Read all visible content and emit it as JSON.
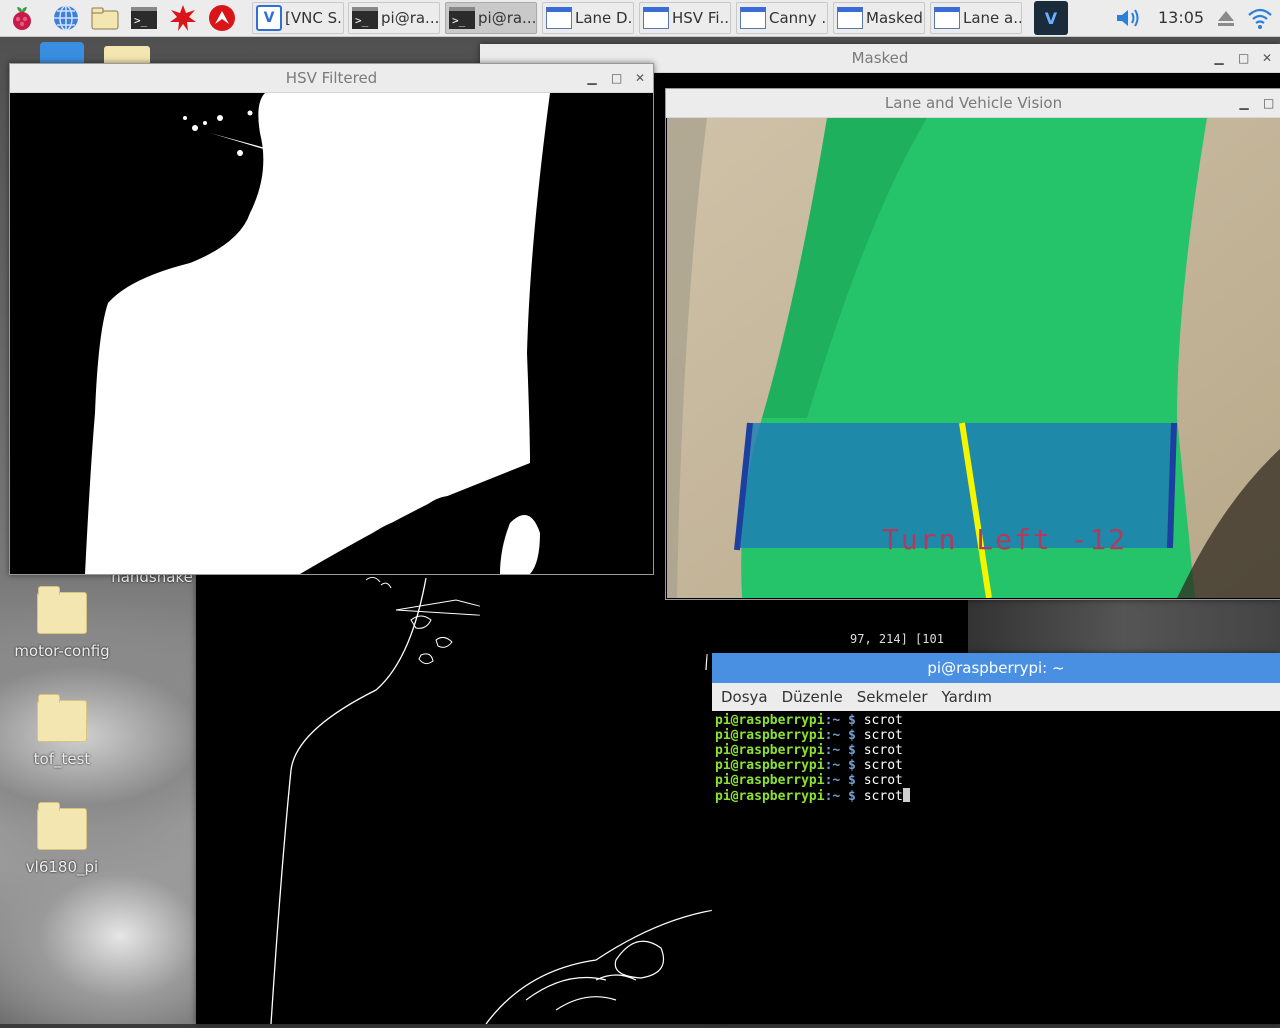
{
  "taskbar": {
    "tasks": [
      {
        "label": "[VNC S...",
        "icon": "vnc-icon"
      },
      {
        "label": "pi@ra...",
        "icon": "terminal-icon"
      },
      {
        "label": "pi@ra...",
        "icon": "terminal-icon"
      },
      {
        "label": "Lane D...",
        "icon": "window-icon"
      },
      {
        "label": "HSV Fi...",
        "icon": "window-icon"
      },
      {
        "label": "Canny ...",
        "icon": "window-icon"
      },
      {
        "label": "Masked",
        "icon": "window-icon"
      },
      {
        "label": "Lane a...",
        "icon": "window-icon"
      }
    ],
    "clock": "13:05"
  },
  "desktop_icons": [
    {
      "label": "handshake"
    },
    {
      "label": "motor-config"
    },
    {
      "label": "tof_test"
    },
    {
      "label": "vl6180_pi"
    }
  ],
  "windows": {
    "masked": {
      "title": "Masked",
      "readout": "97, 214] [101"
    },
    "hsv": {
      "title": "HSV Filtered"
    },
    "lane": {
      "title": "Lane and Vehicle Vision",
      "overlay_text": "Turn Left -12"
    },
    "terminal": {
      "title": "pi@raspberrypi: ~",
      "menu": [
        "Dosya",
        "Düzenle",
        "Sekmeler",
        "Yardım"
      ],
      "lines": [
        {
          "user": "pi@raspberrypi",
          "path": ":~",
          "sym": " $",
          "cmd": " scrot"
        },
        {
          "user": "pi@raspberrypi",
          "path": ":~",
          "sym": " $",
          "cmd": " scrot"
        },
        {
          "user": "pi@raspberrypi",
          "path": ":~",
          "sym": " $",
          "cmd": " scrot"
        },
        {
          "user": "pi@raspberrypi",
          "path": ":~",
          "sym": " $",
          "cmd": " scrot"
        },
        {
          "user": "pi@raspberrypi",
          "path": ":~",
          "sym": " $",
          "cmd": " scrot"
        },
        {
          "user": "pi@raspberrypi",
          "path": ":~",
          "sym": " $",
          "cmd": " scrot"
        }
      ]
    }
  },
  "colors": {
    "lane_green": "#25c46a",
    "overlay_blue": "#1f7fb5",
    "lane_line_blue": "#1d3fa0",
    "lane_line_yellow": "#f5f500",
    "overlay_text": "#b23a5a"
  }
}
